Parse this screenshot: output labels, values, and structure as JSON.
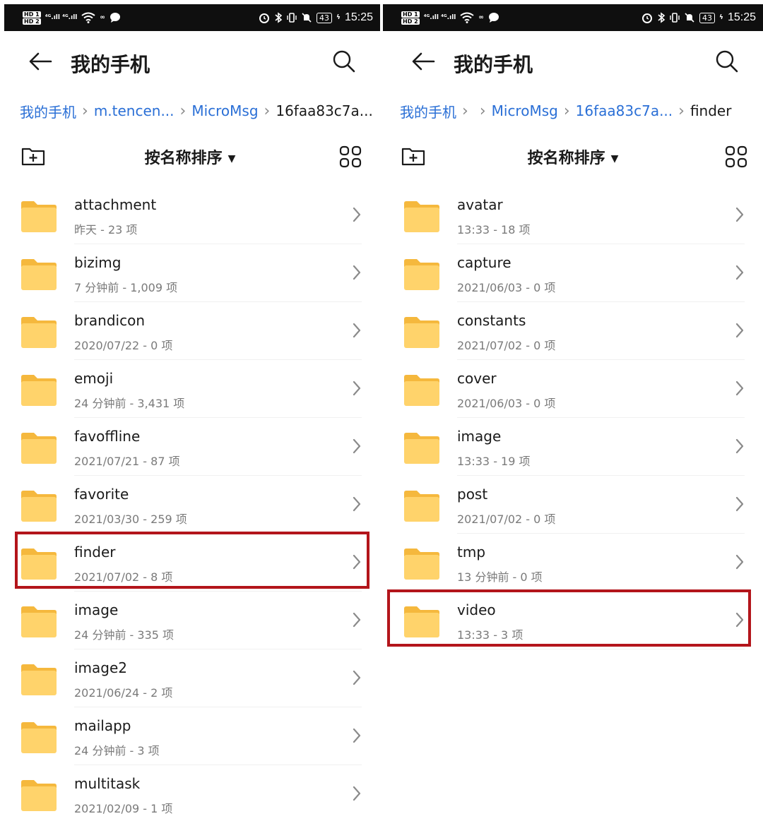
{
  "status_bar": {
    "hd1": "HD 1",
    "hd2": "HD 2",
    "signal": "⁴ᴳ.ıll ⁴ᴳ.ıll",
    "extra": "∞",
    "battery": "43",
    "time": "15:25"
  },
  "left": {
    "title": "我的手机",
    "breadcrumb": [
      "我的手机",
      "m.tencen...",
      "MicroMsg",
      "16faa83c7a..."
    ],
    "sort_label": "按名称排序",
    "folders": [
      {
        "name": "attachment",
        "meta": "昨天 - 23 项"
      },
      {
        "name": "bizimg",
        "meta": "7 分钟前 - 1,009 项"
      },
      {
        "name": "brandicon",
        "meta": "2020/07/22 - 0 项"
      },
      {
        "name": "emoji",
        "meta": "24 分钟前 - 3,431 项"
      },
      {
        "name": "favoffline",
        "meta": "2021/07/21 - 87 项"
      },
      {
        "name": "favorite",
        "meta": "2021/03/30 - 259 项"
      },
      {
        "name": "finder",
        "meta": "2021/07/02 - 8 项",
        "highlighted": true
      },
      {
        "name": "image",
        "meta": "24 分钟前 - 335 项"
      },
      {
        "name": "image2",
        "meta": "2021/06/24 - 2 项"
      },
      {
        "name": "mailapp",
        "meta": "24 分钟前 - 3 项"
      },
      {
        "name": "multitask",
        "meta": "2021/02/09 - 1 项"
      }
    ]
  },
  "right": {
    "title": "我的手机",
    "breadcrumb": [
      "我的手机",
      "",
      "MicroMsg",
      "16faa83c7a...",
      "finder"
    ],
    "sort_label": "按名称排序",
    "folders": [
      {
        "name": "avatar",
        "meta": "13:33 - 18 项"
      },
      {
        "name": "capture",
        "meta": "2021/06/03 - 0 项"
      },
      {
        "name": "constants",
        "meta": "2021/07/02 - 0 项"
      },
      {
        "name": "cover",
        "meta": "2021/06/03 - 0 项"
      },
      {
        "name": "image",
        "meta": "13:33 - 19 项"
      },
      {
        "name": "post",
        "meta": "2021/07/02 - 0 项"
      },
      {
        "name": "tmp",
        "meta": "13 分钟前 - 0 项"
      },
      {
        "name": "video",
        "meta": "13:33 - 3 项",
        "highlighted": true
      }
    ]
  },
  "colors": {
    "folder_body": "#FFD36B",
    "folder_tab": "#F5B83D",
    "breadcrumb_link": "#2A6FD6",
    "highlight": "#B3151B"
  }
}
